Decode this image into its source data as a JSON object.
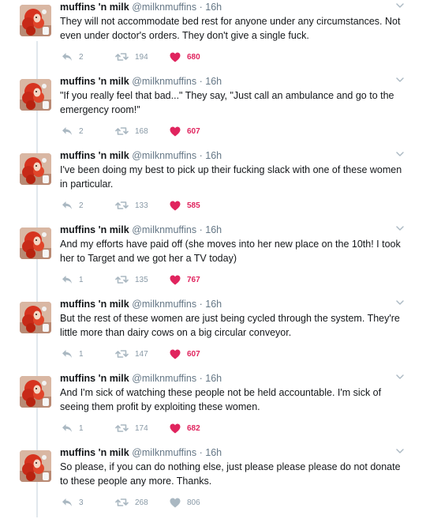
{
  "colors": {
    "like_active": "#e0245e",
    "icon_gray": "#aab8c2",
    "text_gray": "#657786",
    "thread_line": "#e1e8ed"
  },
  "icons": {
    "reply": "reply-icon",
    "retweet": "retweet-icon",
    "like": "heart-icon",
    "menu": "chevron-down-icon"
  },
  "tweets": [
    {
      "name": "muffins 'n milk",
      "handle": "@milknmuffins",
      "dot": "·",
      "time": "16h",
      "text": "They will not accommodate bed rest for anyone under any circumstances. Not even under doctor's orders. They don't give a single fuck.",
      "replies": "2",
      "retweets": "194",
      "likes": "680",
      "liked": true
    },
    {
      "name": "muffins 'n milk",
      "handle": "@milknmuffins",
      "dot": "·",
      "time": "16h",
      "text": "\"If you really feel that bad...\" They say, \"Just call an ambulance and go to the emergency room!\"",
      "replies": "2",
      "retweets": "168",
      "likes": "607",
      "liked": true
    },
    {
      "name": "muffins 'n milk",
      "handle": "@milknmuffins",
      "dot": "·",
      "time": "16h",
      "text": "I've been doing my best to pick up their fucking slack with one of these women in particular.",
      "replies": "2",
      "retweets": "133",
      "likes": "585",
      "liked": true
    },
    {
      "name": "muffins 'n milk",
      "handle": "@milknmuffins",
      "dot": "·",
      "time": "16h",
      "text": "And my efforts have paid off (she moves into her new place on the 10th! I took her to Target and we got her a TV today)",
      "replies": "1",
      "retweets": "135",
      "likes": "767",
      "liked": true
    },
    {
      "name": "muffins 'n milk",
      "handle": "@milknmuffins",
      "dot": "·",
      "time": "16h",
      "text": "But the rest of these women are just being cycled through the system. They're little more than dairy cows on a big circular conveyor.",
      "replies": "1",
      "retweets": "147",
      "likes": "607",
      "liked": true
    },
    {
      "name": "muffins 'n milk",
      "handle": "@milknmuffins",
      "dot": "·",
      "time": "16h",
      "text": "And I'm sick of watching these people not be held accountable. I'm sick of seeing them profit by exploiting these women.",
      "replies": "1",
      "retweets": "174",
      "likes": "682",
      "liked": true
    },
    {
      "name": "muffins 'n milk",
      "handle": "@milknmuffins",
      "dot": "·",
      "time": "16h",
      "text": "So please, if you can do nothing else, just please please please do not donate to these people any more. Thanks.",
      "replies": "3",
      "retweets": "268",
      "likes": "806",
      "liked": false
    }
  ]
}
